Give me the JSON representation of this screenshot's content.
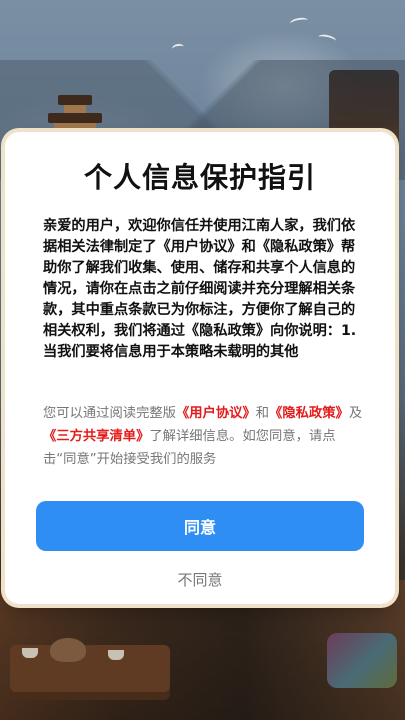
{
  "dialog": {
    "title": "个人信息保护指引",
    "policy_text": "亲爱的用户，欢迎你信任并使用江南人家，我们依据相关法律制定了《用户协议》和《隐私政策》帮助你了解我们收集、使用、储存和共享个人信息的情况，请你在点击之前仔细阅读并充分理解相关条款，其中重点条款已为你标注，方便你了解自己的相关权利，我们将通过《隐私政策》向你说明：1. 当我们要将信息用于本策略未载明的其他",
    "notice": {
      "text_1": "您可以通过阅读完整版",
      "link_user_agreement": "《用户协议》",
      "text_2": "和",
      "link_privacy_policy": "《隐私政策》",
      "text_3": "及",
      "link_third_party_list": "《三方共享清单》",
      "text_4": "了解详细信息。如您同意，请点击“同意”开始接受我们的服务"
    },
    "agree_button": "同意",
    "disagree_button": "不同意"
  },
  "colors": {
    "accent_button": "#2f8ef3",
    "link_red": "#e51b1b",
    "muted_gray": "#777777",
    "frame_beige": "#efe2c9"
  }
}
